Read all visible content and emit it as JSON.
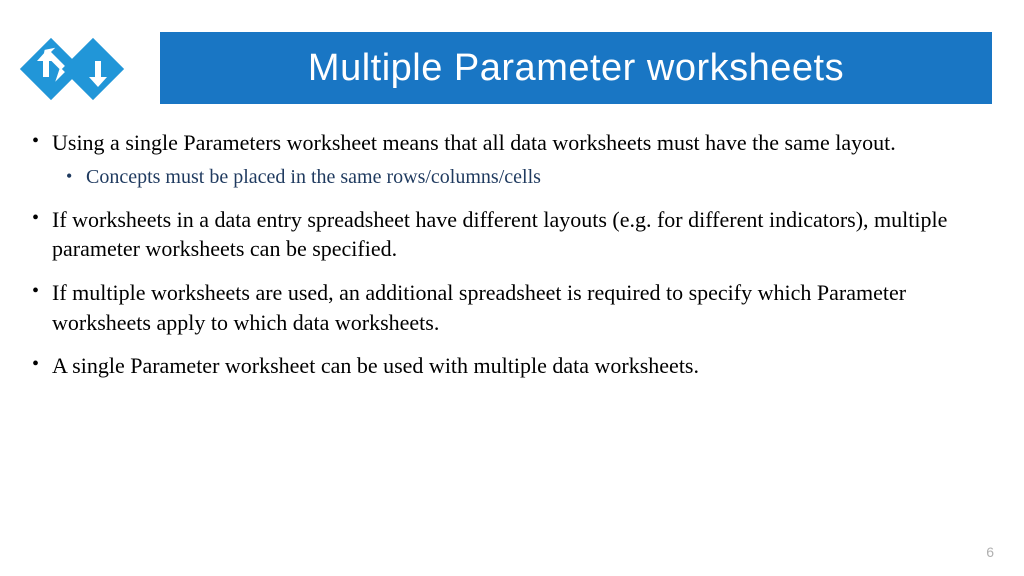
{
  "slide": {
    "title": "Multiple Parameter worksheets",
    "page_number": "6",
    "bullets": [
      {
        "text": "Using a single Parameters worksheet means that all data worksheets must have the same layout.",
        "sub": "Concepts must be placed in the same rows/columns/cells"
      },
      {
        "text": "If worksheets in a data entry spreadsheet have different layouts (e.g. for different indicators), multiple parameter worksheets can be specified."
      },
      {
        "text": "If multiple worksheets are used, an additional spreadsheet is required to specify which Parameter worksheets apply to which data worksheets."
      },
      {
        "text": "A single Parameter worksheet can be used with multiple data worksheets."
      }
    ]
  },
  "colors": {
    "header_bg": "#1976c4",
    "title_text": "#ffffff",
    "body_text": "#000000",
    "sub_text": "#1f3a5f",
    "logo_blue": "#2196d8"
  }
}
